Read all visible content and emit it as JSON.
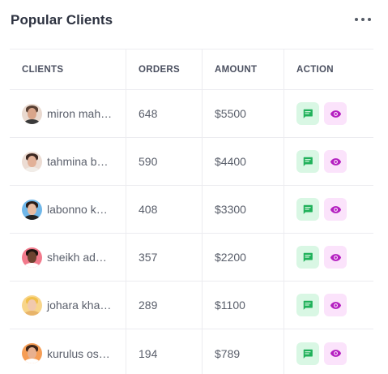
{
  "header": {
    "title": "Popular Clients",
    "menu_icon": "more-horizontal-icon"
  },
  "table": {
    "columns": [
      "CLIENTS",
      "ORDERS",
      "AMOUNT",
      "ACTION"
    ],
    "rows": [
      {
        "client": "miron mah…",
        "orders": "648",
        "amount": "$5500",
        "avatar_bg": "#e9d9cf",
        "hair": "#5a4033",
        "skin": "#d9a58a",
        "shirt": "#3a3a3a"
      },
      {
        "client": "tahmina b…",
        "orders": "590",
        "amount": "$4400",
        "avatar_bg": "#ecdcd3",
        "hair": "#3b2720",
        "skin": "#e2b198",
        "shirt": "#f1ede8"
      },
      {
        "client": "labonno k…",
        "orders": "408",
        "amount": "$3300",
        "avatar_bg": "#6fb7e9",
        "hair": "#2a1c18",
        "skin": "#e7bca3",
        "shirt": "#222222"
      },
      {
        "client": "sheikh ad…",
        "orders": "357",
        "amount": "$2200",
        "avatar_bg": "#f27a8c",
        "hair": "#1f1410",
        "skin": "#6d4330",
        "shirt": "#ffffff"
      },
      {
        "client": "johara kha…",
        "orders": "289",
        "amount": "$1100",
        "avatar_bg": "#f8d58a",
        "hair": "#f1c04b",
        "skin": "#f1c9ad",
        "shirt": "#e8b46a"
      },
      {
        "client": "kurulus os…",
        "orders": "194",
        "amount": "$789",
        "avatar_bg": "#f59d55",
        "hair": "#3d2418",
        "skin": "#e8b08f",
        "shirt": "#ffffff"
      }
    ],
    "actions": {
      "message_icon": "message-icon",
      "view_icon": "eye-icon"
    }
  },
  "colors": {
    "message_icon": "#20b15a",
    "view_icon": "#b41fc0",
    "message_bg": "#d9f7e4",
    "view_bg": "#fbe3fb"
  }
}
